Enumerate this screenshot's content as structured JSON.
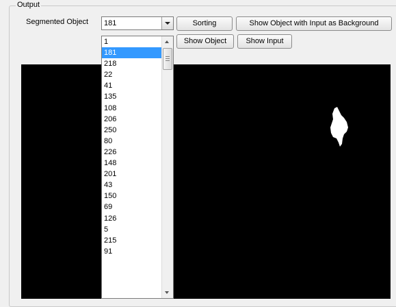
{
  "group": {
    "title": "Output"
  },
  "segmented_object": {
    "label": "Segmented Object",
    "selected_value": "181",
    "options": [
      "1",
      "181",
      "218",
      "22",
      "41",
      "135",
      "108",
      "206",
      "250",
      "80",
      "226",
      "148",
      "201",
      "43",
      "150",
      "69",
      "126",
      "5",
      "215",
      "91"
    ],
    "highlighted_option": "181"
  },
  "buttons": {
    "sorting": "Sorting",
    "show_object_with_input_as_background": "Show Object with Input as Background",
    "show_object": "Show Object",
    "show_input": "Show Input"
  },
  "colors": {
    "canvas_background": "#000000",
    "object_color": "#ffffff",
    "selection_highlight": "#3399ff"
  },
  "icons": {
    "combo_arrow": "chevron-down-icon",
    "scroll_up": "scroll-up-arrow-icon",
    "scroll_down": "scroll-down-arrow-icon"
  }
}
